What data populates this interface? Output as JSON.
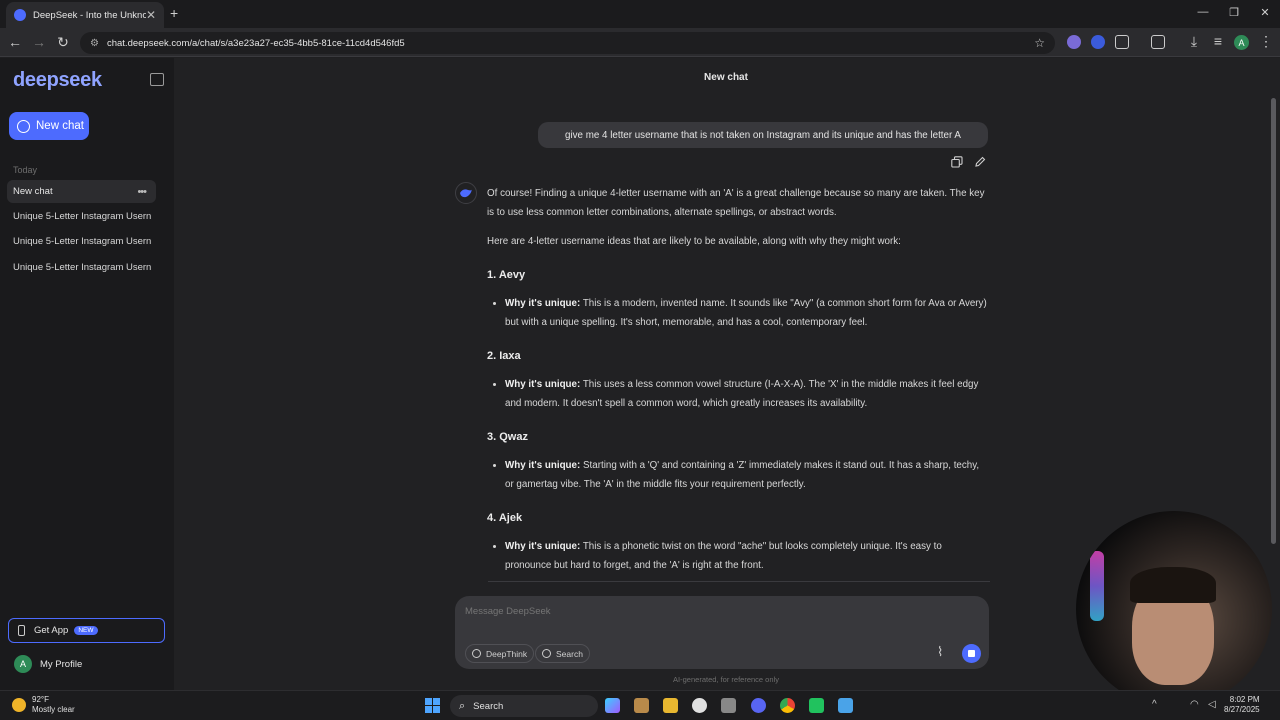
{
  "browser": {
    "tab_title": "DeepSeek - Into the Unknown",
    "url": "chat.deepseek.com/a/chat/s/a3e23a27-ec35-4bb5-81ce-11cd4d546fd5",
    "profile_initial": "A"
  },
  "sidebar": {
    "logo": "deepseek",
    "new_chat_label": "New chat",
    "section_label": "Today",
    "items": [
      {
        "label": "New chat"
      },
      {
        "label": "Unique 5-Letter Instagram Usern"
      },
      {
        "label": "Unique 5-Letter Instagram Usern"
      },
      {
        "label": "Unique 5-Letter Instagram Usern"
      }
    ],
    "get_app_label": "Get App",
    "get_app_badge": "NEW",
    "profile_label": "My Profile",
    "profile_initial": "A"
  },
  "chat": {
    "title": "New chat",
    "user_message": "give me 4 letter username that is not taken on Instagram and its unique and has the letter A",
    "intro1": "Of course! Finding a unique 4-letter username with an 'A' is a great challenge because so many are taken. The key is to use less common letter combinations, alternate spellings, or abstract words.",
    "intro2": "Here are 4-letter username ideas that are likely to be available, along with why they might work:",
    "why_label": "Why it's unique:",
    "ideas": [
      {
        "heading": "1. Aevy",
        "reason": "This is a modern, invented name. It sounds like \"Avy\" (a common short form for Ava or Avery) but with a unique spelling. It's short, memorable, and has a cool, contemporary feel."
      },
      {
        "heading": "2. Iaxa",
        "reason": "This uses a less common vowel structure (I-A-X-A). The 'X' in the middle makes it feel edgy and modern. It doesn't spell a common word, which greatly increases its availability."
      },
      {
        "heading": "3. Qwaz",
        "reason": "Starting with a 'Q' and containing a 'Z' immediately makes it stand out. It has a sharp, techy, or gamertag vibe. The 'A' in the middle fits your requirement perfectly."
      },
      {
        "heading": "4. Ajek",
        "reason": "This is a phonetic twist on the word \"ache\" but looks completely unique. It's easy to pronounce but hard to forget, and the 'A' is right at the front."
      }
    ]
  },
  "composer": {
    "placeholder": "Message DeepSeek",
    "deepthink_label": "DeepThink",
    "search_label": "Search",
    "disclaimer": "AI-generated, for reference only"
  },
  "taskbar": {
    "temperature": "92°F",
    "weather": "Mostly clear",
    "search_label": "Search",
    "time": "8:02 PM",
    "date": "8/27/2025"
  },
  "colors": {
    "accent": "#4d6bfe",
    "background": "#212123",
    "sidebar": "#1a1a1c"
  }
}
